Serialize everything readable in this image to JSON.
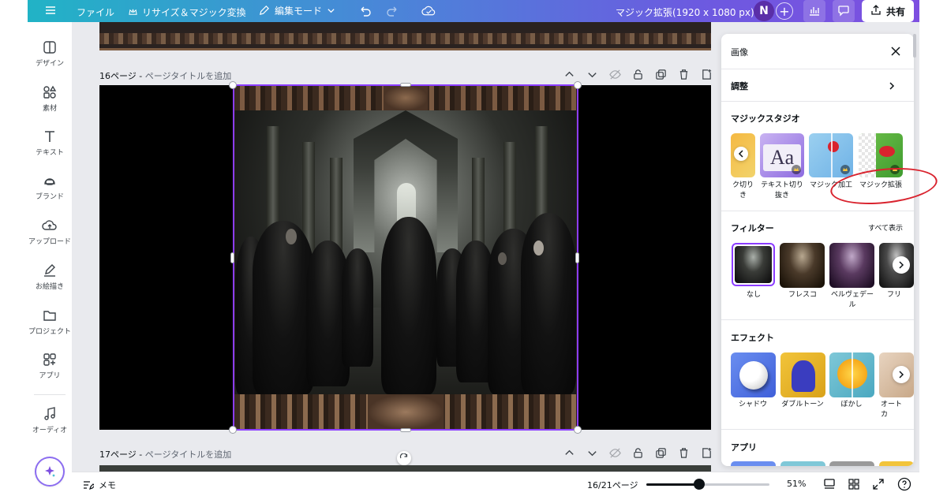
{
  "colors": {
    "accent": "#8b3dff",
    "annotation": "#d9232e"
  },
  "topbar": {
    "menu_icon": "hamburger-icon",
    "file_label": "ファイル",
    "resize_label": "リサイズ＆マジック変換",
    "edit_mode_label": "編集モード",
    "doc_title": "マジック拡張(1920 x 1080 px)",
    "avatar_initial": "N",
    "share_label": "共有"
  },
  "sidebar": {
    "items": [
      {
        "label": "デザイン",
        "icon": "design-icon"
      },
      {
        "label": "素材",
        "icon": "elements-icon"
      },
      {
        "label": "テキスト",
        "icon": "text-icon"
      },
      {
        "label": "ブランド",
        "icon": "brand-icon"
      },
      {
        "label": "アップロード",
        "icon": "upload-icon"
      },
      {
        "label": "お絵描き",
        "icon": "draw-icon"
      },
      {
        "label": "プロジェクト",
        "icon": "folder-icon"
      },
      {
        "label": "アプリ",
        "icon": "apps-icon"
      },
      {
        "label": "オーディオ",
        "icon": "audio-icon"
      }
    ]
  },
  "canvas": {
    "page16_number": "16ページ -",
    "page16_title_placeholder": "ページタイトルを追加",
    "page17_number": "17ページ -",
    "page17_title_placeholder": "ページタイトルを追加"
  },
  "bottombar": {
    "notes_label": "メモ",
    "page_counter": "16/21ページ",
    "zoom_label": "51%",
    "zoom_fraction": 0.43
  },
  "panel": {
    "header": "画像",
    "adjust_label": "調整",
    "magic_studio_heading": "マジックスタジオ",
    "magic_items": [
      {
        "label": "ク切り\nき"
      },
      {
        "label": "テキスト切り\n抜き"
      },
      {
        "label": "マジック加工"
      },
      {
        "label": "マジック拡張"
      }
    ],
    "filters_heading": "フィルター",
    "show_all_label": "すべて表示",
    "filters": [
      {
        "label": "なし"
      },
      {
        "label": "フレスコ"
      },
      {
        "label": "ベルヴェデー\nル"
      },
      {
        "label": "フリ"
      }
    ],
    "effects_heading": "エフェクト",
    "effects": [
      {
        "label": "シャドウ"
      },
      {
        "label": "ダブルトーン"
      },
      {
        "label": "ぼかし"
      },
      {
        "label": "オート\nカ"
      }
    ],
    "apps_heading": "アプリ"
  }
}
